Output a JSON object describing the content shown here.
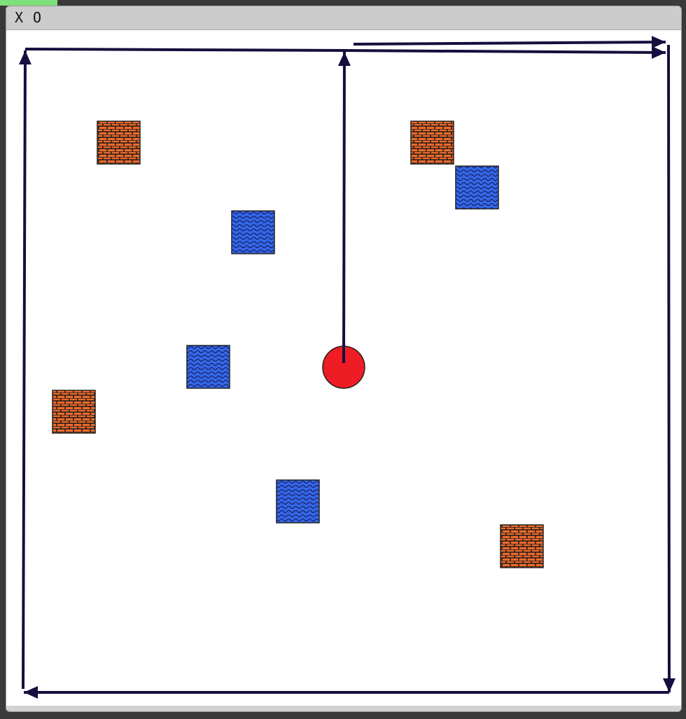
{
  "window": {
    "title_players": [
      "X",
      "O"
    ]
  },
  "colors": {
    "arrow": "#150f3f",
    "brick": "#ee6a2a",
    "brick_mortar": "#1a1a1a",
    "water": "#3566e8",
    "water_wave": "#111a55",
    "ball": "#ee1c24",
    "tab_accent": "#7ee07a"
  },
  "board": {
    "brick_tiles": 4,
    "water_tiles": 4,
    "tiles": [
      {
        "kind": "brick",
        "icon": "brick-wall-icon"
      },
      {
        "kind": "brick",
        "icon": "brick-wall-icon"
      },
      {
        "kind": "water",
        "icon": "water-tile-icon"
      },
      {
        "kind": "water",
        "icon": "water-tile-icon"
      },
      {
        "kind": "water",
        "icon": "water-tile-icon"
      },
      {
        "kind": "brick",
        "icon": "brick-wall-icon"
      },
      {
        "kind": "water",
        "icon": "water-tile-icon"
      },
      {
        "kind": "brick",
        "icon": "brick-wall-icon"
      }
    ],
    "ball": {
      "icon": "red-ball-icon"
    }
  }
}
